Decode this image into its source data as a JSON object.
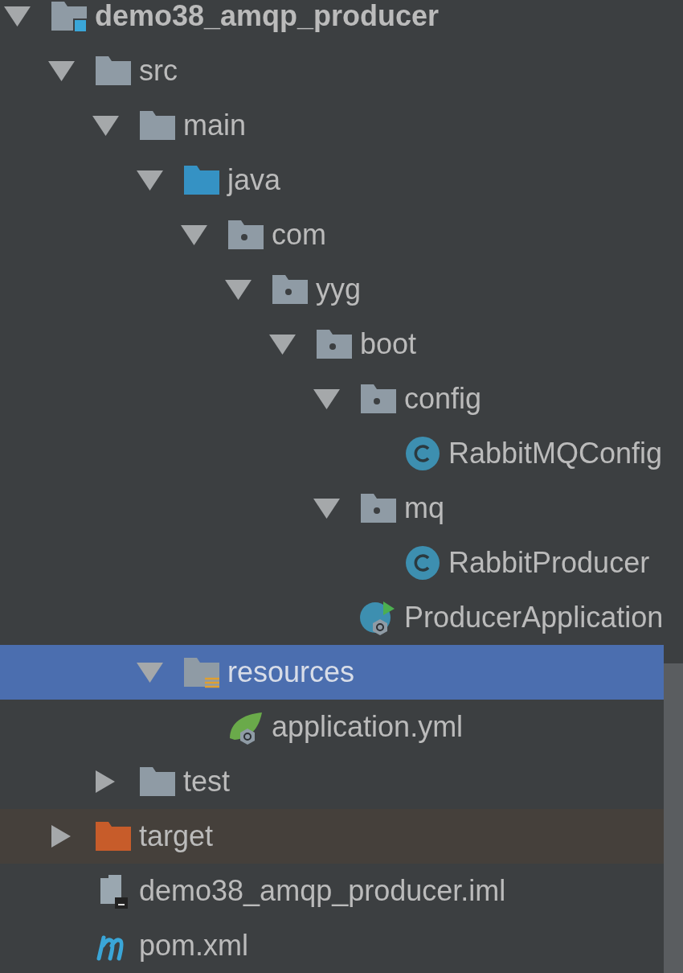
{
  "project_tree": [
    {
      "label": "demo38_amqp_producer",
      "kind": "module",
      "expanded": true,
      "selected": false,
      "children": [
        {
          "label": "src",
          "kind": "folder",
          "expanded": true,
          "selected": false,
          "children": [
            {
              "label": "main",
              "kind": "folder",
              "expanded": true,
              "selected": false,
              "children": [
                {
                  "label": "java",
                  "kind": "source_folder",
                  "expanded": true,
                  "selected": false,
                  "children": [
                    {
                      "label": "com",
                      "kind": "package",
                      "expanded": true,
                      "selected": false,
                      "children": [
                        {
                          "label": "yyg",
                          "kind": "package",
                          "expanded": true,
                          "selected": false,
                          "children": [
                            {
                              "label": "boot",
                              "kind": "package",
                              "expanded": true,
                              "selected": false,
                              "children": [
                                {
                                  "label": "config",
                                  "kind": "package",
                                  "expanded": true,
                                  "selected": false,
                                  "children": [
                                    {
                                      "label": "RabbitMQConfig",
                                      "kind": "class",
                                      "selected": false
                                    }
                                  ]
                                },
                                {
                                  "label": "mq",
                                  "kind": "package",
                                  "expanded": true,
                                  "selected": false,
                                  "children": [
                                    {
                                      "label": "RabbitProducer",
                                      "kind": "class",
                                      "selected": false
                                    }
                                  ]
                                },
                                {
                                  "label": "ProducerApplication",
                                  "kind": "spring_app",
                                  "selected": false
                                }
                              ]
                            }
                          ]
                        }
                      ]
                    }
                  ]
                },
                {
                  "label": "resources",
                  "kind": "resources_folder",
                  "expanded": true,
                  "selected": true,
                  "children": [
                    {
                      "label": "application.yml",
                      "kind": "spring_config",
                      "selected": false
                    }
                  ]
                }
              ]
            },
            {
              "label": "test",
              "kind": "folder",
              "expanded": false,
              "selected": false
            }
          ]
        },
        {
          "label": "target",
          "kind": "excluded_folder",
          "expanded": false,
          "selected": false
        },
        {
          "label": "demo38_amqp_producer.iml",
          "kind": "iml",
          "selected": false
        },
        {
          "label": "pom.xml",
          "kind": "maven",
          "selected": false
        }
      ]
    }
  ]
}
